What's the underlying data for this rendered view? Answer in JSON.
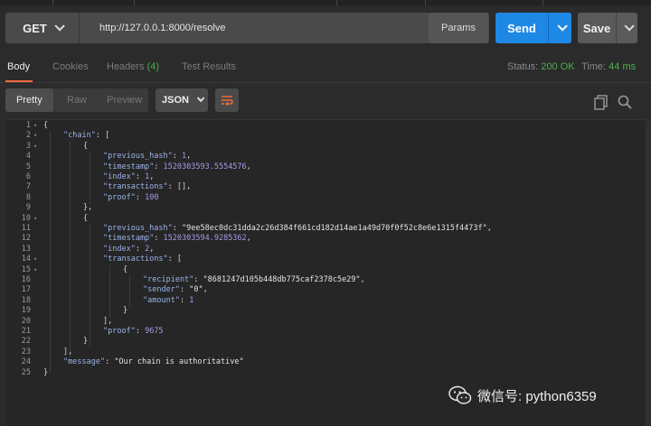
{
  "request": {
    "method": "GET",
    "url": "http://127.0.0.1:8000/resolve",
    "params_label": "Params",
    "send_label": "Send",
    "save_label": "Save"
  },
  "response_tabs": [
    {
      "label": "Body"
    },
    {
      "label": "Cookies"
    },
    {
      "label": "Headers",
      "count": "(4)"
    },
    {
      "label": "Test Results"
    }
  ],
  "status": {
    "status_label": "Status:",
    "status_value": "200 OK",
    "time_label": "Time:",
    "time_value": "44 ms"
  },
  "view_modes": [
    "Pretty",
    "Raw",
    "Preview"
  ],
  "format": "JSON",
  "line_numbers": [
    "1",
    "2",
    "3",
    "4",
    "5",
    "6",
    "7",
    "8",
    "9",
    "10",
    "11",
    "12",
    "13",
    "14",
    "15",
    "16",
    "17",
    "18",
    "19",
    "20",
    "21",
    "22",
    "23",
    "24",
    "25"
  ],
  "code": {
    "l1": "{",
    "l2_key": "\"chain\"",
    "l2_rest": ": [",
    "l3": "{",
    "l4_key": "\"previous_hash\"",
    "l4_val": "1",
    "l5_key": "\"timestamp\"",
    "l5_val": "1520303593.5554576",
    "l6_key": "\"index\"",
    "l6_val": "1",
    "l7_key": "\"transactions\"",
    "l7_val": "[]",
    "l8_key": "\"proof\"",
    "l8_val": "100",
    "l9": "},",
    "l10": "{",
    "l11_key": "\"previous_hash\"",
    "l11_val": "\"9ee58ec0dc31dda2c26d384f661cd182d14ae1a49d70f0f52c8e6e1315f4473f\"",
    "l12_key": "\"timestamp\"",
    "l12_val": "1520303594.9285362",
    "l13_key": "\"index\"",
    "l13_val": "2",
    "l14_key": "\"transactions\"",
    "l14_rest": ": [",
    "l15": "{",
    "l16_key": "\"recipient\"",
    "l16_val": "\"8681247d105b448db775caf2378c5e29\"",
    "l17_key": "\"sender\"",
    "l17_val": "\"0\"",
    "l18_key": "\"amount\"",
    "l18_val": "1",
    "l19": "}",
    "l20": "],",
    "l21_key": "\"proof\"",
    "l21_val": "9675",
    "l22": "}",
    "l23": "],",
    "l24_key": "\"message\"",
    "l24_val": "\"Our chain is authoritative\"",
    "l25": "}"
  },
  "watermark": "微信号: python6359",
  "colors": {
    "accent_send": "#1e88e5",
    "tab_underline": "#f26b3a",
    "status_ok": "#4caf50"
  }
}
